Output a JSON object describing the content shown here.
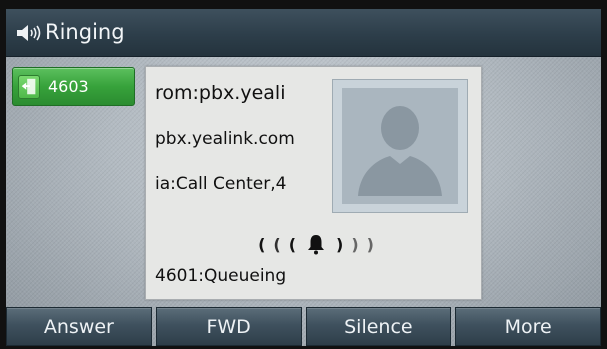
{
  "title_bar": {
    "title": "Ringing",
    "icon": "speaker-volume-icon"
  },
  "line_key": {
    "label": "4603",
    "icon": "phone-door-icon",
    "color": "#37a23b"
  },
  "caller_info": {
    "from": "rom:pbx.yeali",
    "host": "pbx.yealink.com",
    "via": "ia:Call Center,4",
    "ring_indicator_icon": "bell-icon",
    "status": "4601:Queueing",
    "avatar_icon": "person-silhouette-icon"
  },
  "softkeys": [
    {
      "label": "Answer"
    },
    {
      "label": "FWD"
    },
    {
      "label": "Silence"
    },
    {
      "label": "More"
    }
  ]
}
